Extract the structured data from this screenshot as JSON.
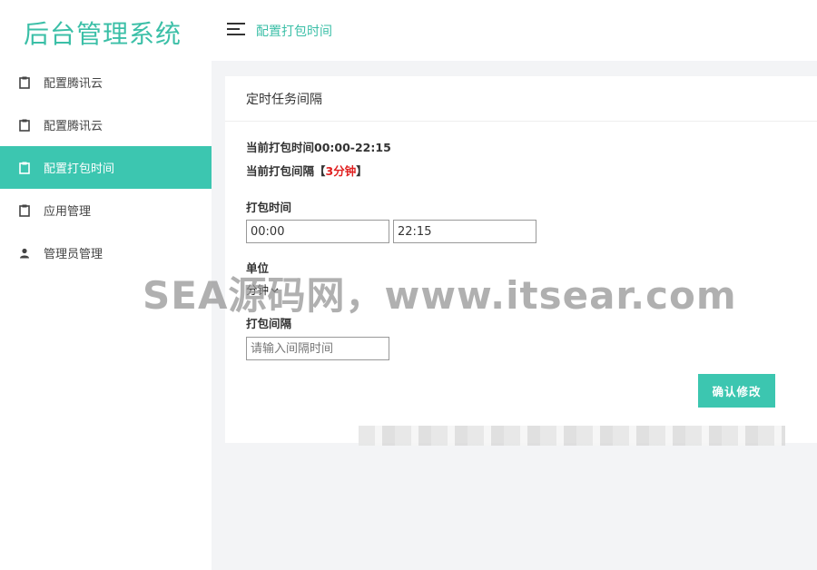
{
  "app": {
    "title": "后台管理系统"
  },
  "sidebar": {
    "items": [
      {
        "label": "配置腾讯云",
        "icon": "clipboard-icon",
        "active": false
      },
      {
        "label": "配置腾讯云",
        "icon": "clipboard-icon",
        "active": false
      },
      {
        "label": "配置打包时间",
        "icon": "clipboard-icon",
        "active": true
      },
      {
        "label": "应用管理",
        "icon": "clipboard-icon",
        "active": false
      },
      {
        "label": "管理员管理",
        "icon": "user-icon",
        "active": false
      }
    ]
  },
  "header": {
    "title": "配置打包时间"
  },
  "card": {
    "title": "定时任务间隔",
    "current_time": "当前打包时间00:00-22:15",
    "current_interval_prefix": "当前打包间隔【",
    "current_interval_value": "3分钟",
    "current_interval_suffix": "】",
    "pack_time_label": "打包时间",
    "start_time": "00:00",
    "end_time": "22:15",
    "unit_label": "单位",
    "unit_value": "分钟",
    "interval_label": "打包间隔",
    "interval_placeholder": "请输入间隔时间",
    "submit_label": "确认修改"
  },
  "watermark": "SEA源码网，www.itsear.com",
  "colors": {
    "accent": "#3cc6b0",
    "logo": "#3bbfa7",
    "highlight": "#e02020"
  }
}
